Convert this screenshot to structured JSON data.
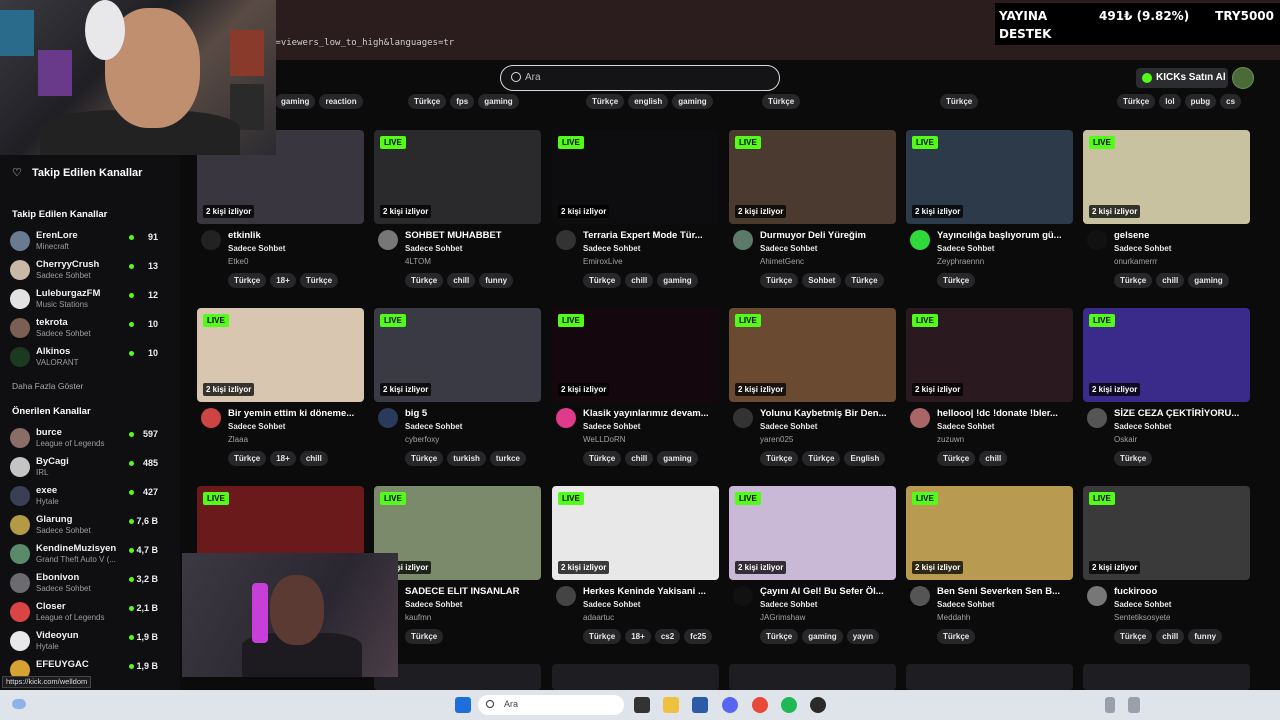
{
  "browser": {
    "url": "t=viewers_low_to_high&languages=tr"
  },
  "overlay": {
    "line1": "YAYINA",
    "line2": "DESTEK",
    "amount": "491₺ (9.82%)",
    "goal": "TRY5000"
  },
  "header": {
    "search_placeholder": "Ara",
    "buy_kicks": "KICKs Satın Al"
  },
  "sidebar": {
    "heading": "Takip Edilen Kanallar",
    "followed_title": "Takip Edilen Kanallar",
    "followed": [
      {
        "name": "ErenLore",
        "category": "Minecraft",
        "viewers": "91",
        "color": "#6a7a90"
      },
      {
        "name": "CherryyCrush",
        "category": "Sadece Sohbet",
        "viewers": "13",
        "color": "#c9b7a8"
      },
      {
        "name": "LuleburgazFM",
        "category": "Music Stations",
        "viewers": "12",
        "color": "#e2e2e2"
      },
      {
        "name": "tekrota",
        "category": "Sadece Sohbet",
        "viewers": "10",
        "color": "#7a5f55"
      },
      {
        "name": "Alkinos",
        "category": "VALORANT",
        "viewers": "10",
        "color": "#1c3a1f"
      }
    ],
    "show_more": "Daha Fazla Göster",
    "recommended_title": "Önerilen Kanallar",
    "recommended": [
      {
        "name": "burce",
        "category": "League of Legends",
        "viewers": "597",
        "color": "#8a6d66"
      },
      {
        "name": "ByCagi",
        "category": "IRL",
        "viewers": "485",
        "color": "#c4c4c4"
      },
      {
        "name": "exee",
        "category": "Hytale",
        "viewers": "427",
        "color": "#3a3f55"
      },
      {
        "name": "Glarung",
        "category": "Sadece Sohbet",
        "viewers": "7,6 B",
        "color": "#b59a45"
      },
      {
        "name": "KendineMuzisyen",
        "category": "Grand Theft Auto V (...",
        "viewers": "4,7 B",
        "color": "#5a8a6a"
      },
      {
        "name": "Ebonivon",
        "category": "Sadece Sohbet",
        "viewers": "3,2 B",
        "color": "#6b6b70"
      },
      {
        "name": "Closer",
        "category": "League of Legends",
        "viewers": "2,1 B",
        "color": "#d94545"
      },
      {
        "name": "Videoyun",
        "category": "Hytale",
        "viewers": "1,9 B",
        "color": "#e8e8e8"
      },
      {
        "name": "EFEUYGAC",
        "category": "",
        "viewers": "1,9 B",
        "color": "#d8a230"
      }
    ]
  },
  "top_tags": [
    [
      "gaming",
      "reaction"
    ],
    [
      "Türkçe",
      "fps",
      "gaming"
    ],
    [
      "Türkçe",
      "english",
      "gaming"
    ],
    [
      "Türkçe"
    ],
    [
      "Türkçe"
    ],
    [
      "Türkçe",
      "lol",
      "pubg",
      "cs"
    ]
  ],
  "live_label": "LIVE",
  "rows": [
    [
      {
        "title": "etkinlik",
        "category": "Sadece Sohbet",
        "user": "Etke0",
        "viewers": "2 kişi izliyor",
        "tags": [
          "Türkçe",
          "18+",
          "Türkçe"
        ],
        "thumb": "#3a3640",
        "av": "#222"
      },
      {
        "title": "SOHBET MUHABBET",
        "category": "Sadece Sohbet",
        "user": "4LTOM",
        "viewers": "2 kişi izliyor",
        "tags": [
          "Türkçe",
          "chill",
          "funny"
        ],
        "thumb": "#2a2a2c",
        "av": "#777"
      },
      {
        "title": "Terraria Expert Mode Tür...",
        "category": "Sadece Sohbet",
        "user": "EmiroxLive",
        "viewers": "2 kişi izliyor",
        "tags": [
          "Türkçe",
          "chill",
          "gaming"
        ],
        "thumb": "#0d0d0f",
        "av": "#333"
      },
      {
        "title": "Durmuyor Deli Yüreğim",
        "category": "Sadece Sohbet",
        "user": "AhimetGenc",
        "viewers": "2 kişi izliyor",
        "tags": [
          "Türkçe",
          "Sohbet",
          "Türkçe"
        ],
        "thumb": "#4a3a30",
        "av": "#5a7a6a"
      },
      {
        "title": "Yayıncılığa başlıyorum gü...",
        "category": "Sadece Sohbet",
        "user": "Zeyphraennn",
        "viewers": "2 kişi izliyor",
        "tags": [
          "Türkçe"
        ],
        "thumb": "#2c3a4a",
        "av": "#2fd93a"
      },
      {
        "title": "gelsene",
        "category": "Sadece Sohbet",
        "user": "onurkamerrr",
        "viewers": "2 kişi izliyor",
        "tags": [
          "Türkçe",
          "chill",
          "gaming"
        ],
        "thumb": "#c8c2a0",
        "av": "#111"
      }
    ],
    [
      {
        "title": "Bir yemin ettim ki döneme...",
        "category": "Sadece Sohbet",
        "user": "Zlaaa",
        "viewers": "2 kişi izliyor",
        "tags": [
          "Türkçe",
          "18+",
          "chill"
        ],
        "thumb": "#d9c6b0",
        "av": "#c44"
      },
      {
        "title": "big 5",
        "category": "Sadece Sohbet",
        "user": "cyberfoxy",
        "viewers": "2 kişi izliyor",
        "tags": [
          "Türkçe",
          "turkish",
          "turkce"
        ],
        "thumb": "#3a3a44",
        "av": "#2a3a5a"
      },
      {
        "title": "Klasik yayınlarımız devam...",
        "category": "Sadece Sohbet",
        "user": "WeLLDoRN",
        "viewers": "2 kişi izliyor",
        "tags": [
          "Türkçe",
          "chill",
          "gaming"
        ],
        "thumb": "#14080e",
        "av": "#e03a8a"
      },
      {
        "title": "Yolunu Kaybetmiş Bir Den...",
        "category": "Sadece Sohbet",
        "user": "yaren025",
        "viewers": "2 kişi izliyor",
        "tags": [
          "Türkçe",
          "Türkçe",
          "English"
        ],
        "thumb": "#6a4a30",
        "av": "#333"
      },
      {
        "title": "hellooo| !dc !donate !bler...",
        "category": "Sadece Sohbet",
        "user": "zuzuwn",
        "viewers": "2 kişi izliyor",
        "tags": [
          "Türkçe",
          "chill"
        ],
        "thumb": "#2a1a20",
        "av": "#a66"
      },
      {
        "title": "SİZE CEZA ÇEKTİRİYORU...",
        "category": "Sadece Sohbet",
        "user": "Oskair",
        "viewers": "2 kişi izliyor",
        "tags": [
          "Türkçe"
        ],
        "thumb": "#3a2a8a",
        "av": "#555"
      }
    ],
    [
      {
        "title": "",
        "category": "",
        "user": "",
        "viewers": "",
        "tags": [],
        "thumb": "#6a1a1a",
        "av": "#333"
      },
      {
        "title": "SADECE ELIT INSANLAR",
        "category": "Sadece Sohbet",
        "user": "kaufmn",
        "viewers": "2 kişi izliyor",
        "tags": [
          "Türkçe"
        ],
        "thumb": "#7a8a6a",
        "av": "#222"
      },
      {
        "title": "Herkes Keninde Yakisani ...",
        "category": "Sadece Sohbet",
        "user": "adaartuc",
        "viewers": "2 kişi izliyor",
        "tags": [
          "Türkçe",
          "18+",
          "cs2",
          "fc25"
        ],
        "thumb": "#e8e8e8",
        "av": "#444"
      },
      {
        "title": "Çayını Al Gel! Bu Sefer Öl...",
        "category": "Sadece Sohbet",
        "user": "JAGrimshaw",
        "viewers": "2 kişi izliyor",
        "tags": [
          "Türkçe",
          "gaming",
          "yayın"
        ],
        "thumb": "#c9b8d6",
        "av": "#111"
      },
      {
        "title": "Ben Seni Severken Sen B...",
        "category": "Sadece Sohbet",
        "user": "Meddahh",
        "viewers": "2 kişi izliyor",
        "tags": [
          "Türkçe"
        ],
        "thumb": "#b89a50",
        "av": "#555"
      },
      {
        "title": "fuckirooo",
        "category": "Sadece Sohbet",
        "user": "Sentetiksosyete",
        "viewers": "2 kişi izliyor",
        "tags": [
          "Türkçe",
          "chill",
          "funny"
        ],
        "thumb": "#3a3a3a",
        "av": "#777"
      }
    ]
  ],
  "status_url": "https://kick.com/welldom",
  "taskbar": {
    "search": "Ara"
  }
}
